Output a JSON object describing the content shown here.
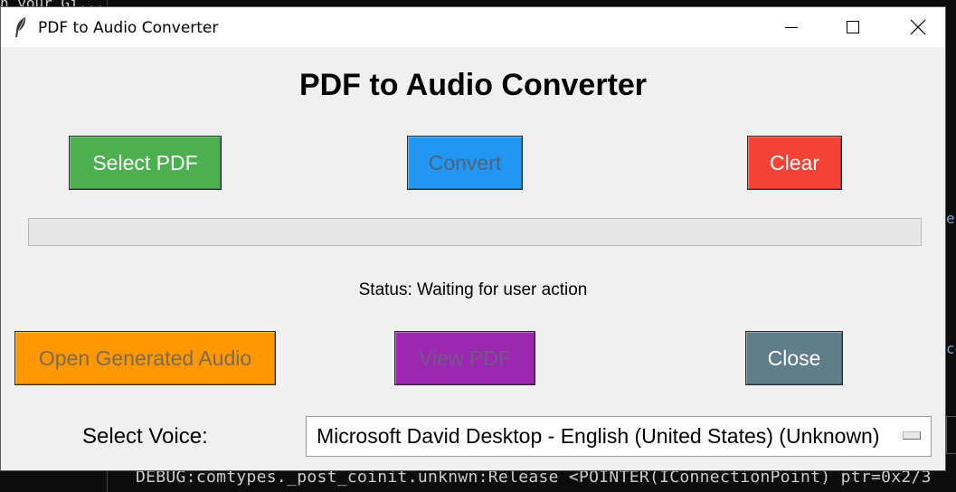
{
  "background": {
    "top_text": "n your Gi...",
    "side_text_1": "el",
    "side_text_2": "ce",
    "debug_line": "DEBUG:comtypes._post_coinit.unknwn:Release <POINTER(IConnectionPoint) ptr=0x2/3"
  },
  "window": {
    "title": "PDF to Audio Converter",
    "icon": "feather-icon"
  },
  "app": {
    "heading": "PDF to Audio Converter",
    "buttons": {
      "select_pdf": "Select PDF",
      "convert": "Convert",
      "clear": "Clear",
      "open_audio": "Open Generated Audio",
      "view_pdf": "View PDF",
      "close": "Close"
    },
    "progress_fraction": 0,
    "status": "Status: Waiting for user action",
    "voice_label": "Select Voice:",
    "voice_selected": "Microsoft David Desktop - English (United States) (Unknown)"
  },
  "colors": {
    "select_pdf": "#4caf50",
    "convert": "#2196f3",
    "clear": "#f44336",
    "open_audio": "#ff9800",
    "view_pdf": "#9c27b0",
    "close": "#607d8b"
  }
}
